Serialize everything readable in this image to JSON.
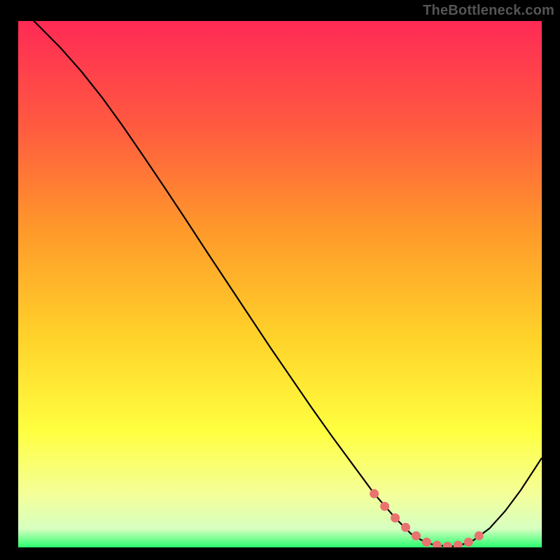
{
  "watermark": "TheBottleneck.com",
  "colors": {
    "bg": "#000000",
    "curve": "#000000",
    "marker_fill": "#e8736f",
    "marker_stroke": "#d75c58",
    "gradient_top": "#ff2a55",
    "gradient_mid1": "#ff6a3a",
    "gradient_mid2": "#ffb02a",
    "gradient_mid3": "#ffe02a",
    "gradient_mid4": "#ffff55",
    "gradient_mid5": "#f6ffb0",
    "gradient_bottom": "#2aff6e"
  },
  "chart_data": {
    "type": "line",
    "title": "",
    "xlabel": "",
    "ylabel": "",
    "xlim": [
      0,
      100
    ],
    "ylim": [
      0,
      100
    ],
    "grid": false,
    "legend": false,
    "series": [
      {
        "name": "bottleneck-curve",
        "x": [
          0,
          4,
          8,
          12,
          16,
          20,
          24,
          28,
          32,
          36,
          40,
          44,
          48,
          52,
          56,
          60,
          64,
          68,
          72,
          75,
          77,
          79,
          81,
          83,
          85,
          87,
          90,
          93,
          96,
          100
        ],
        "y": [
          103,
          99,
          95,
          90.5,
          85.5,
          80,
          74.2,
          68.3,
          62.3,
          56.2,
          50.2,
          44.2,
          38.2,
          32.4,
          26.6,
          21,
          15.6,
          10.2,
          5.6,
          2.6,
          1.4,
          0.6,
          0.3,
          0.2,
          0.6,
          1.4,
          3.6,
          6.9,
          10.9,
          17
        ]
      }
    ],
    "markers": {
      "name": "highlight-region",
      "x": [
        68,
        70,
        72,
        74,
        76,
        78,
        80,
        82,
        84,
        86,
        88
      ],
      "y": [
        10.2,
        7.8,
        5.6,
        3.8,
        2.2,
        1.0,
        0.4,
        0.2,
        0.4,
        1.0,
        2.2
      ]
    },
    "background_gradient": {
      "orientation": "vertical",
      "stops": [
        {
          "offset": 0.0,
          "color": "#ff2a55"
        },
        {
          "offset": 0.2,
          "color": "#ff5a40"
        },
        {
          "offset": 0.4,
          "color": "#ff9a2a"
        },
        {
          "offset": 0.6,
          "color": "#ffd22a"
        },
        {
          "offset": 0.78,
          "color": "#ffff40"
        },
        {
          "offset": 0.9,
          "color": "#f4ff9a"
        },
        {
          "offset": 0.965,
          "color": "#d6ffc0"
        },
        {
          "offset": 1.0,
          "color": "#28ff6e"
        }
      ]
    }
  }
}
